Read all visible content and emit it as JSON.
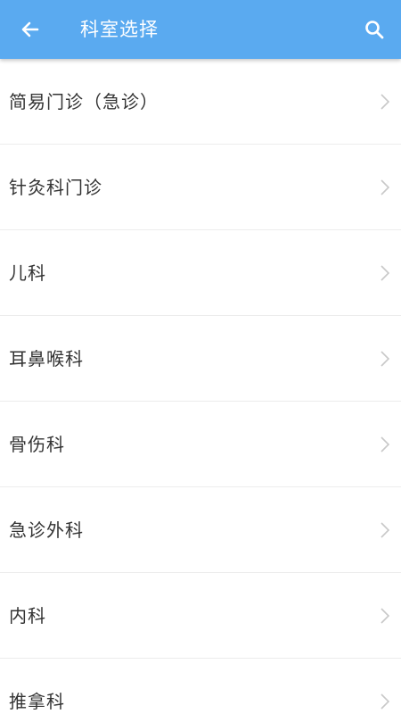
{
  "header": {
    "title": "科室选择",
    "back_icon": "arrow-left-icon",
    "search_icon": "search-icon",
    "color": "#5aaaf0"
  },
  "departments": [
    {
      "label": "简易门诊（急诊）"
    },
    {
      "label": "针灸科门诊"
    },
    {
      "label": "儿科"
    },
    {
      "label": "耳鼻喉科"
    },
    {
      "label": "骨伤科"
    },
    {
      "label": "急诊外科"
    },
    {
      "label": "内科"
    },
    {
      "label": "推拿科"
    }
  ]
}
